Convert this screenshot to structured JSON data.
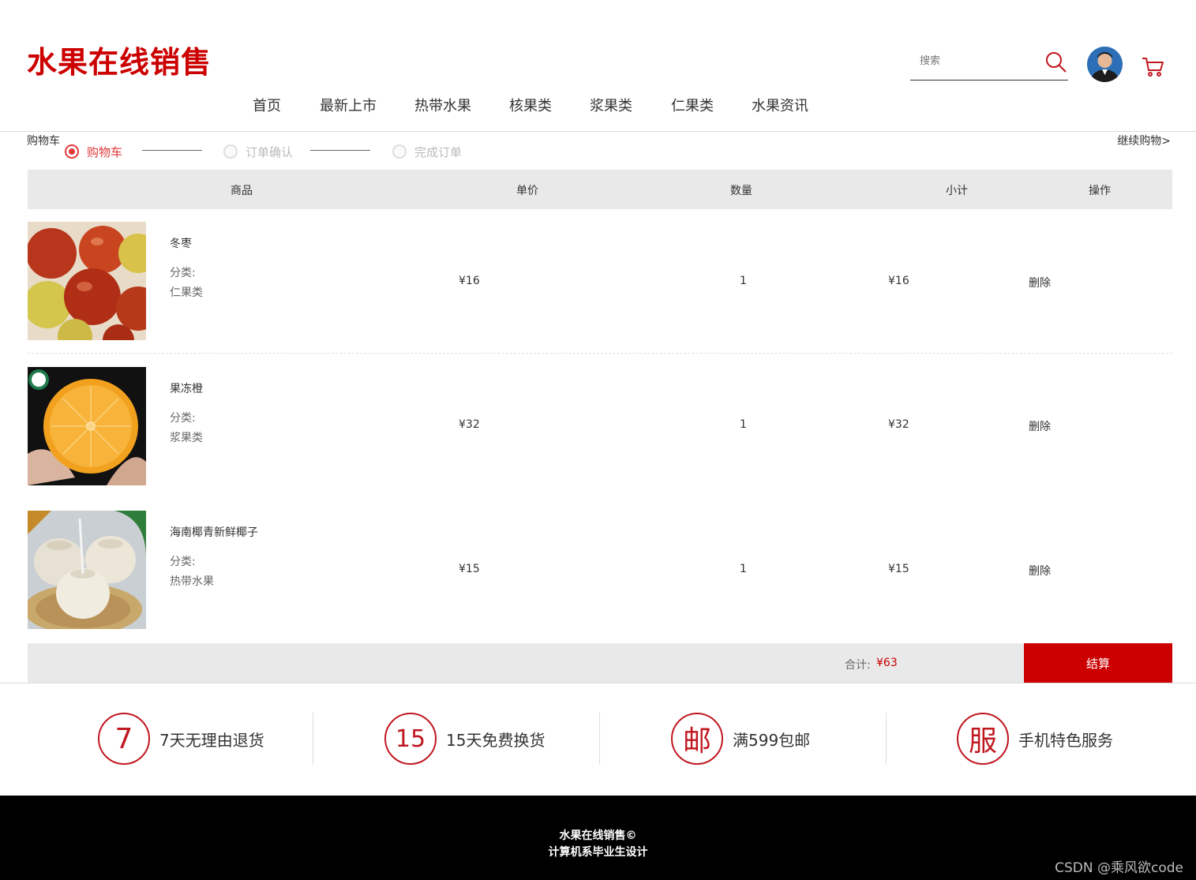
{
  "site": {
    "logo": "水果在线销售"
  },
  "search": {
    "placeholder": "搜索"
  },
  "nav": [
    "首页",
    "最新上市",
    "热带水果",
    "核果类",
    "浆果类",
    "仁果类",
    "水果资讯"
  ],
  "cart": {
    "title": "购物车",
    "continue_label": "继续购物>",
    "steps": [
      "购物车",
      "订单确认",
      "完成订单"
    ]
  },
  "table": {
    "headers": [
      "商品",
      "单价",
      "数量",
      "小计",
      "操作"
    ],
    "rows": [
      {
        "name": "冬枣",
        "category_label": "分类:",
        "category": "仁果类",
        "price": "¥16",
        "quantity": "1",
        "subtotal": "¥16",
        "action": "删除"
      },
      {
        "name": "果冻橙",
        "category_label": "分类:",
        "category": "浆果类",
        "price": "¥32",
        "quantity": "1",
        "subtotal": "¥32",
        "action": "删除"
      },
      {
        "name": "海南椰青新鲜椰子",
        "category_label": "分类:",
        "category": "热带水果",
        "price": "¥15",
        "quantity": "1",
        "subtotal": "¥15",
        "action": "删除"
      }
    ],
    "total_label": "合计:",
    "total_value": "¥63",
    "checkout_label": "结算"
  },
  "services": [
    {
      "badge": "7",
      "text": "7天无理由退货"
    },
    {
      "badge": "15",
      "text": "15天免费换货"
    },
    {
      "badge": "邮",
      "text": "满599包邮"
    },
    {
      "badge": "服",
      "text": "手机特色服务"
    }
  ],
  "footer": {
    "line1": "水果在线销售©",
    "line2": "计算机系毕业生设计"
  },
  "watermark": "CSDN @乘风欲code",
  "colors": {
    "brand": "#cc0000",
    "active_step": "#e03a3a"
  }
}
